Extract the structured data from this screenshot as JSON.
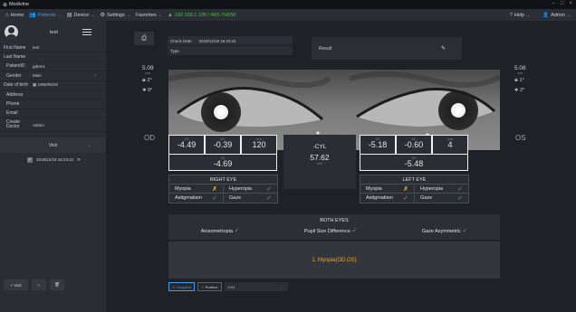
{
  "app": {
    "title": "Medivine",
    "window_controls": [
      "–",
      "□",
      "×"
    ]
  },
  "menu": {
    "items": [
      {
        "label": "Home",
        "icon": "home-icon"
      },
      {
        "label": "Patients",
        "icon": "patients-icon",
        "active": true
      },
      {
        "label": "Device",
        "icon": "device-icon"
      },
      {
        "label": "Settings",
        "icon": "settings-icon"
      },
      {
        "label": "Favorites",
        "icon": "star-icon"
      }
    ],
    "status": "192.168.1.105 / 4K5-7HDW",
    "help": "Help",
    "admin": "Admin"
  },
  "patient": {
    "name": "test",
    "fields": [
      {
        "label": "First Name",
        "value": "test"
      },
      {
        "label": "Last Name",
        "value": ""
      },
      {
        "label": "PatientID",
        "value": "gdnm1"
      },
      {
        "label": "Gender",
        "value": "Male"
      },
      {
        "label": "Date of birth",
        "value": "1990/05/20"
      },
      {
        "label": "Address",
        "value": ""
      },
      {
        "label": "Phone",
        "value": ""
      },
      {
        "label": "Email",
        "value": ""
      },
      {
        "label": "Create Doctor",
        "value": "Admin"
      }
    ],
    "visits_header": "Visit",
    "visits": [
      {
        "date": "2018/12/18 16:23:41"
      }
    ],
    "buttons": {
      "add_visit": "+ Visit",
      "add": "+",
      "delete": "🗑"
    }
  },
  "exam": {
    "check_date_label": "Check Date",
    "check_date": "2018/12/18 16:23:41",
    "type_label": "Type",
    "type_value": "",
    "result_label": "Result",
    "od_label": "OD",
    "os_label": "OS",
    "od_pupil": {
      "size": "5.09",
      "unit": "mm",
      "angle1": "2°",
      "angle2": "0°"
    },
    "os_pupil": {
      "size": "5.08",
      "unit": "mm",
      "angle1": "1°",
      "angle2": "2°"
    },
    "right": {
      "ds": "-4.49",
      "dc": "-0.39",
      "axis": "120",
      "se": "-4.69"
    },
    "left": {
      "ds": "-5.18",
      "dc": "-0.60",
      "axis": "4",
      "se": "-5.48"
    },
    "col_labels": {
      "ds": "DS",
      "dc": "DC",
      "axis": "Axis",
      "se": "SE"
    },
    "cyl": {
      "title": "-CYL",
      "value": "57.62",
      "unit": "mm"
    },
    "right_eye_title": "RIGHT EYE",
    "left_eye_title": "LEFT EYE",
    "conditions": {
      "myopia": "Myopia",
      "hyperopia": "Hyperopia",
      "astigmatism": "Astigmatism",
      "gaze": "Gaze"
    },
    "both_eyes_title": "BOTH EYES",
    "both": {
      "aniso": "Anisometropia",
      "pupil_diff": "Pupil Size Difference",
      "gaze_asym": "Gaze Asymmetric"
    },
    "diagnosis": "1. Myopia(OD,OS)",
    "bottom": {
      "negative": "Negative",
      "positive": "Positive",
      "select_value": "0.01"
    }
  },
  "colors": {
    "accent": "#3f9cf0",
    "ok": "#45c03c",
    "warn": "#f0c22a",
    "result": "#f0a12c"
  }
}
